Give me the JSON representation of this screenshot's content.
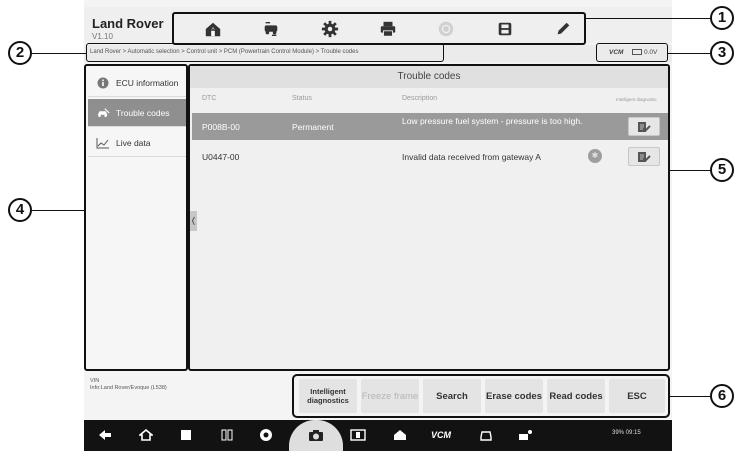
{
  "app": {
    "title": "Land Rover",
    "version": "V1.10"
  },
  "toolbar": {
    "buttons": [
      {
        "name": "home-icon"
      },
      {
        "name": "vehicle-swap-icon"
      },
      {
        "name": "settings-icon"
      },
      {
        "name": "print-icon"
      },
      {
        "name": "help-icon"
      },
      {
        "name": "save-icon"
      },
      {
        "name": "edit-icon"
      }
    ]
  },
  "breadcrumb": {
    "text": "Land Rover > Automatic selection > Control unit > PCM (Powertrain Control Module) > Trouble codes"
  },
  "vcm": {
    "label": "VCM",
    "battery": "0.0V"
  },
  "sidebar": {
    "items": [
      {
        "label": "ECU information",
        "icon": "info-icon"
      },
      {
        "label": "Trouble codes",
        "icon": "car-wrench-icon"
      },
      {
        "label": "Live data",
        "icon": "graph-icon"
      }
    ]
  },
  "panel": {
    "title": "Trouble codes",
    "columns": {
      "dtc": "DTC",
      "status": "Status",
      "description": "Description",
      "diag": "Intelligent diagnostic"
    },
    "rows": [
      {
        "dtc": "P008B-00",
        "status": "Permanent",
        "description": "Low pressure fuel system - pressure is too high."
      },
      {
        "dtc": "U0447-00",
        "status": "",
        "description": "Invalid data received from gateway A"
      }
    ]
  },
  "vin": {
    "label": "VIN",
    "info": "Info:Land Rover/Evoque (L538)"
  },
  "actions": {
    "intelligent": "Intelligent diagnostics",
    "freeze": "Freeze frame",
    "search": "Search",
    "erase": "Erase codes",
    "read": "Read codes",
    "esc": "ESC"
  },
  "navbar": {
    "vcm_label": "VCM",
    "status": "39% 09:15"
  },
  "callouts": [
    "1",
    "2",
    "3",
    "4",
    "5",
    "6"
  ]
}
